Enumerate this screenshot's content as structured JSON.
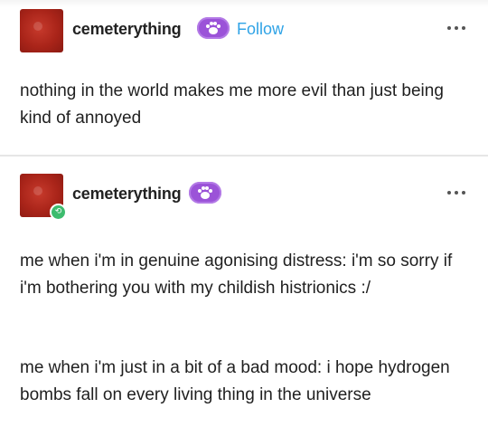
{
  "posts": [
    {
      "username": "cemeterything",
      "follow_label": "Follow",
      "paragraphs": [
        "nothing in the world makes me more evil than just being kind of annoyed"
      ]
    },
    {
      "username": "cemeterything",
      "paragraphs": [
        "me when i'm in genuine agonising distress: i'm so sorry if i'm bothering you with my childish histrionics :/",
        "me when i'm just in a bit of a bad mood: i hope hydrogen bombs fall on every living thing in the universe"
      ]
    }
  ],
  "icons": {
    "badge": "paw-print-badge-icon",
    "more": "more-options-icon",
    "reblog": "reblog-icon"
  },
  "colors": {
    "follow": "#2fa3e6",
    "badge": "#9b53d8",
    "reblog": "#3dbc6e",
    "avatar": "#a92419"
  }
}
